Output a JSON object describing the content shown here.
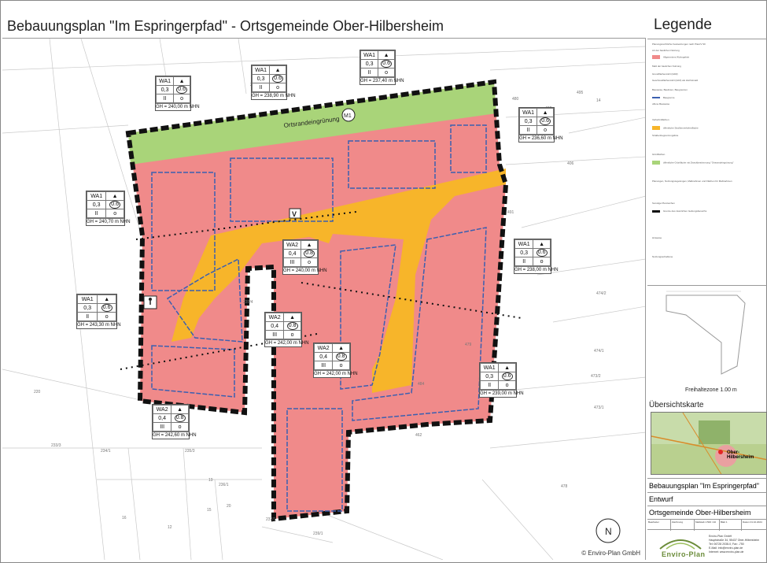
{
  "title": "Bebauungsplan \"Im Espringerpfad\" - Ortsgemeinde Ober-Hilbersheim",
  "legend": {
    "title": "Legende",
    "rows": [
      "Planungsrechtliche Festsetzungen nach PlanzV 90",
      "Art der baulichen Nutzung",
      "Allgemeines Wohngebiet",
      "Maß der baulichen Nutzung",
      "Grundflächenzahl (GRZ)",
      "Geschossflächenzahl (GFZ) als Höchstmaß",
      "Bauweise, Baulinien, Baugrenzen",
      "Baugrenze",
      "offene Bauweise",
      "Verkehrsflächen",
      "öffentliche Straßenverkehrsfläche",
      "Straßenbegrenzungslinie",
      "Grünflächen",
      "öffentliche Grünfläche mit Zweckbestimmung \"Ortsrandeingrünung\"",
      "Planungen, Nutzungsregelungen, Maßnahmen und Flächen für Maßnahmen",
      "Sonstige Planzeichen",
      "Grenze des räumlichen Geltungsbereichs",
      "Hinweise",
      "Nutzungsschablone"
    ]
  },
  "section": {
    "caption": "Freihaltezone 1.00 m"
  },
  "overview": {
    "title": "Übersichtskarte",
    "label": "Ober-Hilbersheim"
  },
  "plan_info": {
    "name": "Bebauungsplan \"Im Espringerpfad\"",
    "stage": "Entwurf",
    "community": "Ortsgemeinde Ober-Hilbersheim",
    "meta": [
      "Bearbeiter",
      "Zeichnung",
      "Maßstab 1:500 / A0",
      "Blatt 1",
      "Datum 01.10.2024"
    ]
  },
  "company": {
    "name": "Enviro-Plan",
    "address": [
      "Enviro-Plan GmbH",
      "Hauptstraße 34, 55437 Ober-Hilbersheim",
      "Tel: 06728 2038-0, Fax: -750",
      "E-Mail: info@enviro-plan.de",
      "Internet: www.enviro-plan.de"
    ]
  },
  "map": {
    "credit": "© Enviro-Plan GmbH",
    "green_label": "Ortsrandeingrünung",
    "green_badge": "M1",
    "road_badge": "V",
    "parcel_numbers": [
      "225",
      "480",
      "492",
      "495",
      "406",
      "491",
      "474/2",
      "474/1",
      "473/2",
      "473/1",
      "478",
      "479",
      "484",
      "462",
      "220",
      "233/3",
      "234/1",
      "235/3",
      "236/1",
      "237/1",
      "239/1",
      "16",
      "12",
      "15",
      "19",
      "20",
      "14",
      "235/4"
    ],
    "colors": {
      "residential": "#f08a8a",
      "road": "#f7b52a",
      "green": "#a9d479",
      "boundary": "#111111",
      "build_line": "#3b5fb0"
    },
    "usage_boxes": [
      {
        "zone": "WA1",
        "grz": "0,3",
        "gfz": "0.6",
        "storeys": "II",
        "type": "o",
        "gh": "GH = 240,00 m NHN"
      },
      {
        "zone": "WA1",
        "grz": "0,3",
        "gfz": "0.6",
        "storeys": "II",
        "type": "o",
        "gh": "GH = 238,90 m NHN"
      },
      {
        "zone": "WA1",
        "grz": "0,3",
        "gfz": "0.6",
        "storeys": "II",
        "type": "o",
        "gh": "GH = 237,40 m NHN"
      },
      {
        "zone": "WA1",
        "grz": "0,3",
        "gfz": "0.6",
        "storeys": "II",
        "type": "o",
        "gh": "GH = 236,60 m NHN"
      },
      {
        "zone": "WA1",
        "grz": "0,3",
        "gfz": "0.6",
        "storeys": "II",
        "type": "o",
        "gh": "GH = 240,70 m NHN"
      },
      {
        "zone": "WA2",
        "grz": "0,4",
        "gfz": "0.8",
        "storeys": "III",
        "type": "o",
        "gh": "GH = 240,00 m NHN"
      },
      {
        "zone": "WA1",
        "grz": "0,3",
        "gfz": "0.6",
        "storeys": "II",
        "type": "o",
        "gh": "GH = 238,00 m NHN"
      },
      {
        "zone": "WA1",
        "grz": "0,3",
        "gfz": "0.6",
        "storeys": "II",
        "type": "o",
        "gh": "GH = 243,30 m NHN"
      },
      {
        "zone": "WA2",
        "grz": "0,4",
        "gfz": "0.8",
        "storeys": "III",
        "type": "o",
        "gh": "GH = 242,00 m NHN"
      },
      {
        "zone": "WA2",
        "grz": "0,4",
        "gfz": "0.8",
        "storeys": "III",
        "type": "o",
        "gh": "GH = 242,00 m NHN"
      },
      {
        "zone": "WA1",
        "grz": "0,3",
        "gfz": "0.6",
        "storeys": "II",
        "type": "o",
        "gh": "GH = 239,00 m NHN"
      },
      {
        "zone": "WA2",
        "grz": "0,4",
        "gfz": "0.8",
        "storeys": "III",
        "type": "o",
        "gh": "GH = 242,60 m NHN"
      }
    ]
  }
}
